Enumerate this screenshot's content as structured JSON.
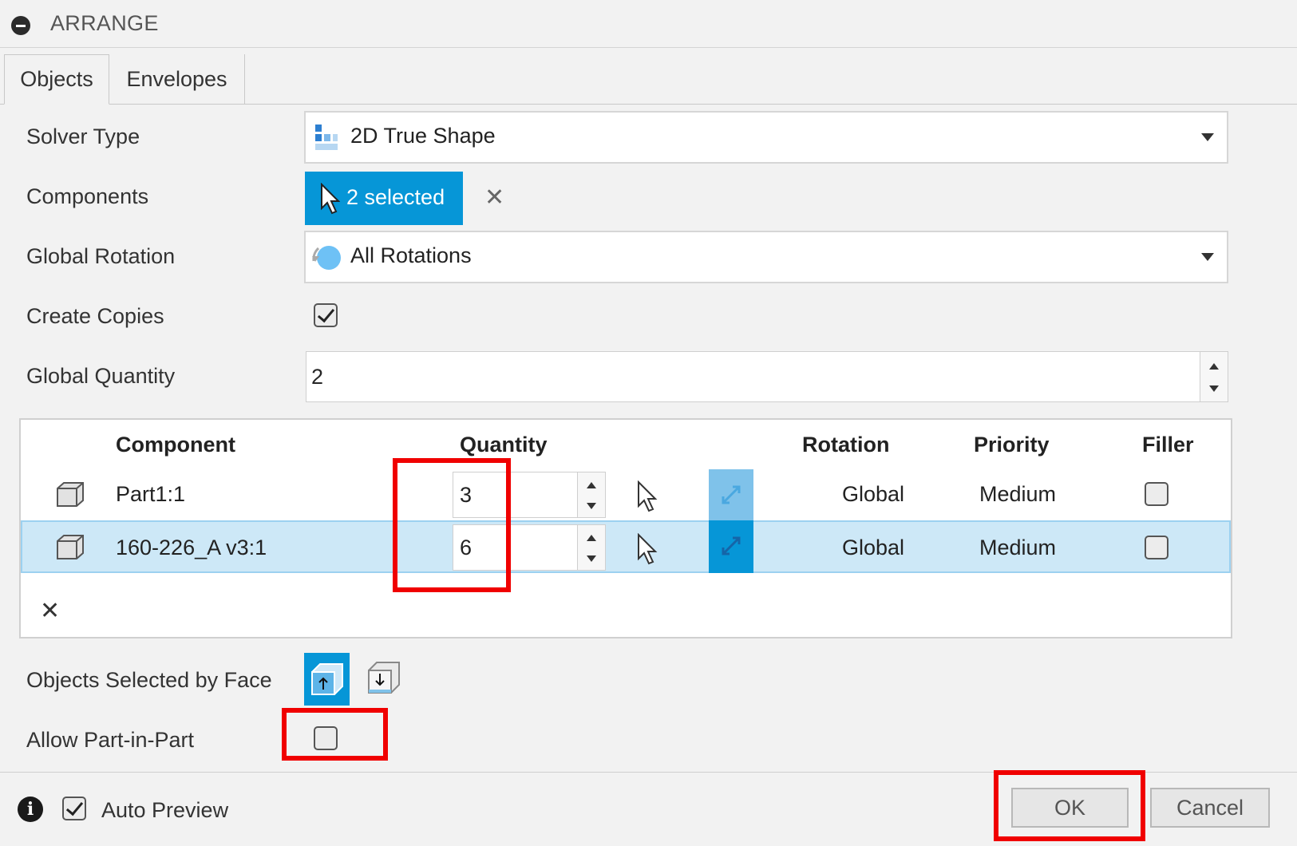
{
  "dialog": {
    "title": "ARRANGE",
    "tabs": [
      {
        "label": "Objects"
      },
      {
        "label": "Envelopes"
      }
    ],
    "active_tab": "Objects"
  },
  "form": {
    "solver_type": {
      "label": "Solver Type",
      "value": "2D True Shape"
    },
    "components": {
      "label": "Components",
      "button": "2 selected"
    },
    "global_rotation": {
      "label": "Global Rotation",
      "value": "All Rotations"
    },
    "create_copies": {
      "label": "Create Copies",
      "checked": true
    },
    "global_quantity": {
      "label": "Global Quantity",
      "value": "2"
    }
  },
  "table": {
    "headers": {
      "component": "Component",
      "quantity": "Quantity",
      "rotation": "Rotation",
      "priority": "Priority",
      "filler": "Filler"
    },
    "rows": [
      {
        "component": "Part1:1",
        "quantity": "3",
        "rotation": "Global",
        "priority": "Medium",
        "filler": false,
        "selected": false
      },
      {
        "component": "160-226_A v3:1",
        "quantity": "6",
        "rotation": "Global",
        "priority": "Medium",
        "filler": false,
        "selected": true
      }
    ]
  },
  "options": {
    "objects_selected_by_face": {
      "label": "Objects Selected by Face"
    },
    "allow_part_in_part": {
      "label": "Allow Part-in-Part",
      "checked": false
    }
  },
  "footer": {
    "auto_preview": {
      "label": "Auto Preview",
      "checked": true
    },
    "ok_label": "OK",
    "cancel_label": "Cancel"
  },
  "colors": {
    "accent": "#0696d7",
    "highlight_row": "#cde8f7",
    "annotation_red": "#f00000"
  },
  "icons": [
    "collapse-icon",
    "solver-type-icon",
    "pointer-icon",
    "clear-icon",
    "rotation-icon",
    "part-icon",
    "rotation-toggle-icon",
    "remove-icon",
    "face-up-icon",
    "face-down-icon",
    "info-icon"
  ]
}
